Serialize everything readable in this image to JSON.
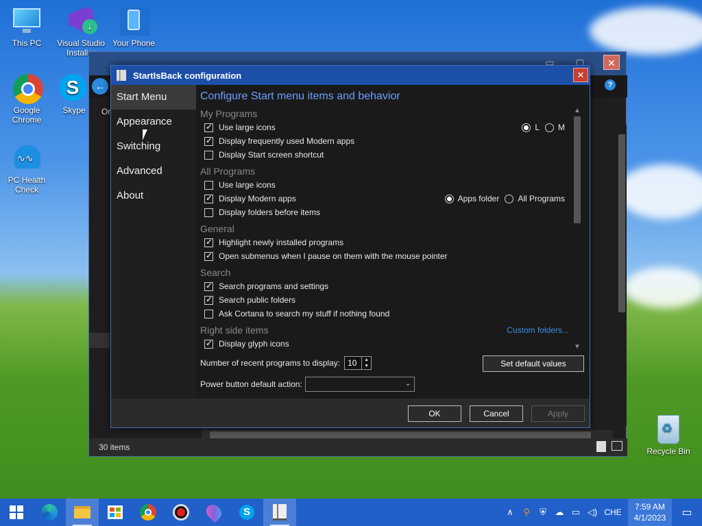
{
  "desktop": {
    "icons": [
      {
        "label": "This PC"
      },
      {
        "label": "Visual Studio Installer"
      },
      {
        "label": "Your Phone"
      },
      {
        "label": "Google Chrome"
      },
      {
        "label": "Skype"
      },
      {
        "label": "PC Health Check"
      },
      {
        "label": "Recycle Bin"
      }
    ]
  },
  "explorer": {
    "status_items": "30 items",
    "partial_text": "Or"
  },
  "dialog": {
    "title": "StartIsBack configuration",
    "close": "✕",
    "sidebar": [
      {
        "label": "Start Menu",
        "active": true
      },
      {
        "label": "Appearance"
      },
      {
        "label": "Switching"
      },
      {
        "label": "Advanced"
      },
      {
        "label": "About"
      }
    ],
    "heading": "Configure Start menu items and behavior",
    "groups": {
      "my_programs": {
        "title": "My Programs",
        "opts": [
          {
            "label": "Use large icons",
            "checked": true
          },
          {
            "label": "Display frequently used Modern apps",
            "checked": true
          },
          {
            "label": "Display Start screen shortcut",
            "checked": false
          }
        ],
        "radio_l": "L",
        "radio_m": "M"
      },
      "all_programs": {
        "title": "All Programs",
        "opts": [
          {
            "label": "Use large icons",
            "checked": false
          },
          {
            "label": "Display Modern apps",
            "checked": true
          },
          {
            "label": "Display folders before items",
            "checked": false
          }
        ],
        "radio_apps": "Apps folder",
        "radio_all": "All Programs"
      },
      "general": {
        "title": "General",
        "opts": [
          {
            "label": "Highlight newly installed programs",
            "checked": true
          },
          {
            "label": "Open submenus when I pause on them with the mouse pointer",
            "checked": true
          }
        ]
      },
      "search": {
        "title": "Search",
        "opts": [
          {
            "label": "Search programs and settings",
            "checked": true
          },
          {
            "label": "Search public folders",
            "checked": true
          },
          {
            "label": "Ask Cortana to search my stuff if nothing found",
            "checked": false
          }
        ]
      },
      "right_side": {
        "title": "Right side items",
        "link": "Custom folders...",
        "opts": [
          {
            "label": "Display glyph icons",
            "checked": true
          }
        ]
      }
    },
    "recent_label": "Number of recent programs to display:",
    "recent_value": "10",
    "set_default": "Set default values",
    "power_label": "Power button default action:",
    "power_value": "",
    "ok": "OK",
    "cancel": "Cancel",
    "apply": "Apply"
  },
  "taskbar": {
    "lang": "CHE",
    "time": "7:59 AM",
    "date": "4/1/2023"
  },
  "colors": {
    "accent": "#1b4fa8",
    "link": "#3a8ee6",
    "heading": "#6aa0ff"
  }
}
